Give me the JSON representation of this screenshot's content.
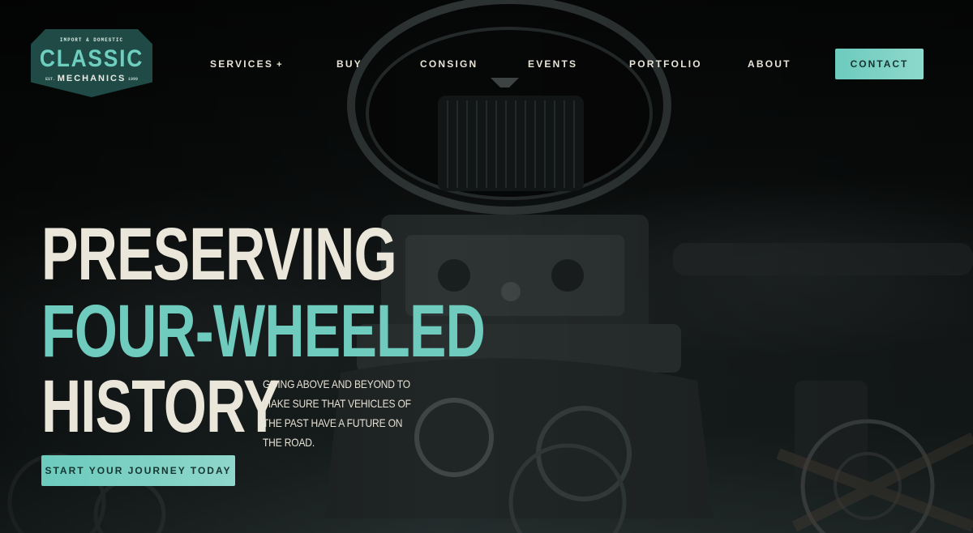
{
  "logo": {
    "top_text": "IMPORT & DOMESTIC",
    "main_text": "CLASSIC",
    "sub_text": "MECHANICS",
    "est_text": "EST.",
    "year_text": "1999"
  },
  "nav": {
    "items": [
      {
        "label": "SERVICES",
        "suffix": "+"
      },
      {
        "label": "BUY"
      },
      {
        "label": "CONSIGN"
      },
      {
        "label": "EVENTS"
      },
      {
        "label": "PORTFOLIO"
      },
      {
        "label": "ABOUT"
      }
    ],
    "contact_label": "CONTACT"
  },
  "hero": {
    "line_1": "PRESERVING",
    "line_2": "FOUR-WHEELED",
    "line_3": "HISTORY",
    "tagline": "GOING ABOVE AND BEYOND TO MAKE SURE THAT VEHICLES OF THE PAST HAVE A FUTURE ON THE ROAD.",
    "cta_label": "START YOUR JOURNEY TODAY"
  },
  "colors": {
    "accent": "#6ecbbd",
    "headline_light": "#ebe6da",
    "logo_bg": "#1f4a45",
    "button_text": "#163531"
  }
}
